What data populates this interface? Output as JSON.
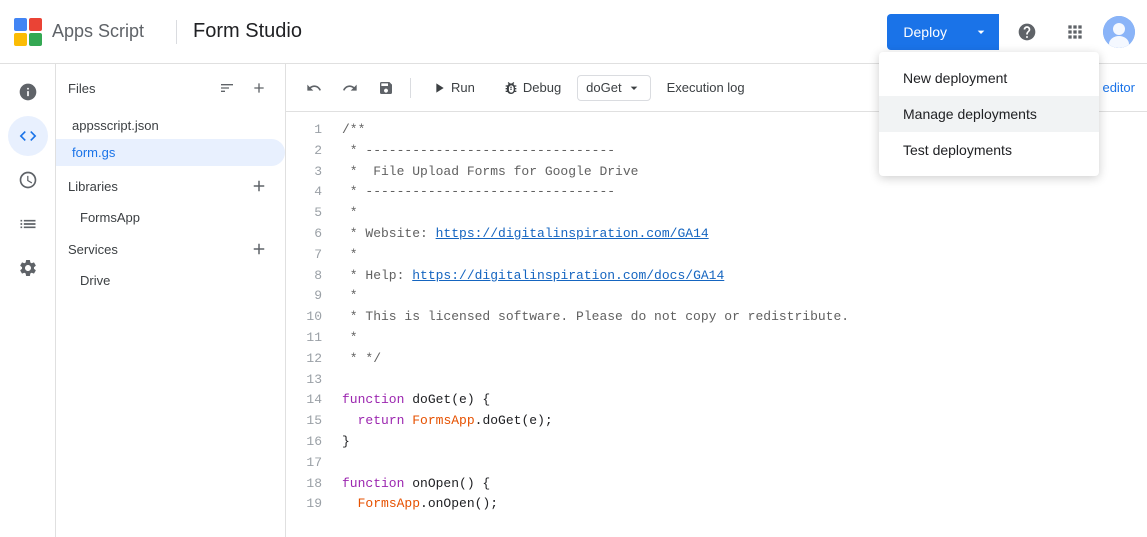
{
  "header": {
    "apps_script_label": "Apps Script",
    "project_title": "Form Studio",
    "deploy_button_label": "Deploy",
    "help_icon": "?",
    "classic_editor_link": "e classic editor"
  },
  "toolbar": {
    "undo_title": "Undo",
    "redo_title": "Redo",
    "save_title": "Save",
    "run_label": "Run",
    "debug_label": "Debug",
    "function_name": "doGet",
    "exec_log_label": "Execution log"
  },
  "file_panel": {
    "title": "Files",
    "files": [
      {
        "name": "appsscript.json",
        "active": false
      },
      {
        "name": "form.gs",
        "active": true
      }
    ],
    "libraries_title": "Libraries",
    "libraries": [
      {
        "name": "FormsApp"
      }
    ],
    "services_title": "Services",
    "drive_item": "Drive"
  },
  "deploy_menu": {
    "items": [
      {
        "label": "New deployment",
        "active": false
      },
      {
        "label": "Manage deployments",
        "active": true
      },
      {
        "label": "Test deployments",
        "active": false
      }
    ]
  },
  "code": {
    "lines": [
      {
        "num": 1,
        "text": "/**",
        "type": "comment"
      },
      {
        "num": 2,
        "text": " * --------------------------------",
        "type": "comment"
      },
      {
        "num": 3,
        "text": " *  File Upload Forms for Google Drive",
        "type": "comment"
      },
      {
        "num": 4,
        "text": " * --------------------------------",
        "type": "comment"
      },
      {
        "num": 5,
        "text": " *",
        "type": "comment"
      },
      {
        "num": 6,
        "text": " * Website: https://digitalinspiration.com/GA14",
        "type": "comment_link",
        "link": "https://digitalinspiration.com/GA14",
        "prefix": " * Website: "
      },
      {
        "num": 7,
        "text": " *",
        "type": "comment"
      },
      {
        "num": 8,
        "text": " * Help: https://digitalinspiration.com/docs/GA14",
        "type": "comment_link",
        "link": "https://digitalinspiration.com/docs/GA14",
        "prefix": " * Help: "
      },
      {
        "num": 9,
        "text": " *",
        "type": "comment"
      },
      {
        "num": 10,
        "text": " * This is licensed software. Please do not copy or redistribute.",
        "type": "comment"
      },
      {
        "num": 11,
        "text": " *",
        "type": "comment"
      },
      {
        "num": 12,
        "text": " * */",
        "type": "comment"
      },
      {
        "num": 13,
        "text": "",
        "type": "blank"
      },
      {
        "num": 14,
        "text": "function doGet(e) {",
        "type": "code",
        "keyword": "function",
        "rest": " doGet(e) {"
      },
      {
        "num": 15,
        "text": "  return FormsApp.doGet(e);",
        "type": "code_obj",
        "keyword": "return",
        "obj": "FormsApp",
        "rest": ".doGet(e);"
      },
      {
        "num": 16,
        "text": "}",
        "type": "code"
      },
      {
        "num": 17,
        "text": "",
        "type": "blank"
      },
      {
        "num": 18,
        "text": "function onOpen() {",
        "type": "code",
        "keyword": "function",
        "rest": " onOpen() {"
      },
      {
        "num": 19,
        "text": "  FormsApp.onOpen();",
        "type": "code_obj",
        "obj": "FormsApp",
        "rest": ".onOpen();"
      }
    ]
  }
}
